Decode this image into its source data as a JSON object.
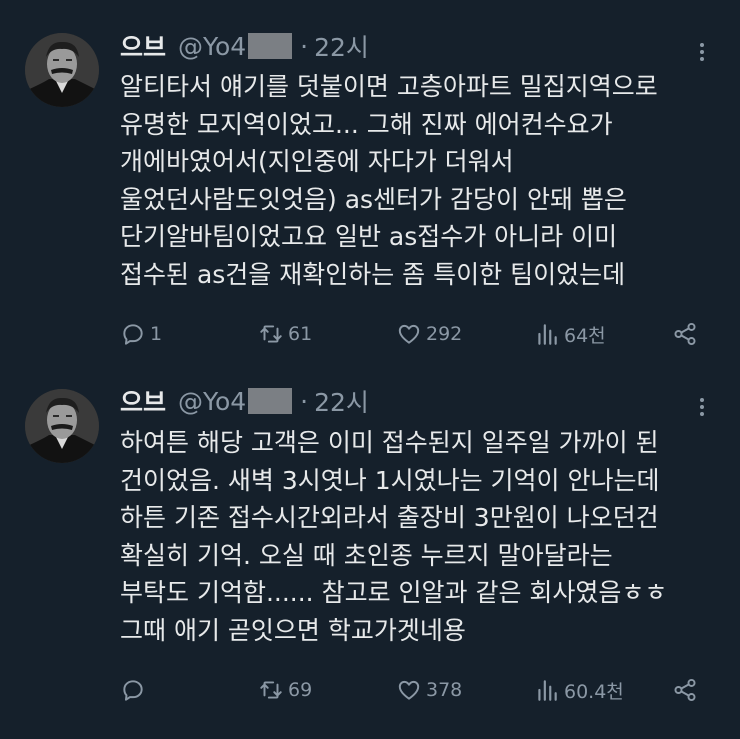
{
  "tweets": [
    {
      "author_name": "으브",
      "handle": "@Yo4",
      "time": "22시",
      "lines": [
        "알티타서 얘기를 덧붙이면 고층아파트 밀집지역으로",
        "유명한 모지역이었고... 그해 진짜 에어컨수요가",
        "개에바였어서(지인중에 자다가 더워서",
        "울었던사람도잇엇음) as센터가 감당이 안돼 뽑은",
        "단기알바팀이었고요 일반 as접수가 아니라 이미",
        "접수된 as건을 재확인하는 좀 특이한 팀이었는데"
      ],
      "replies": "1",
      "retweets": "61",
      "likes": "292",
      "views": "64천"
    },
    {
      "author_name": "으브",
      "handle": "@Yo4",
      "time": "22시",
      "lines": [
        "하여튼 해당 고객은 이미 접수된지 일주일 가까이 된",
        "건이었음. 새벽 3시엿나 1시였나는 기억이 안나는데",
        "하튼 기존 접수시간외라서 출장비 3만원이 나오던건",
        "확실히 기억. 오실 때 초인종 누르지 말아달라는",
        "부탁도 기억함...... 참고로 인알과 같은 회사였음ㅎㅎ",
        "그때 애기 곧잇으면 학교가겟네용"
      ],
      "replies": "",
      "retweets": "69",
      "likes": "378",
      "views": "60.4천"
    }
  ],
  "colors": {
    "background": "#15202b",
    "text": "#e7e9ea",
    "secondary": "#8b98a5",
    "redaction": "#7b7f84"
  }
}
